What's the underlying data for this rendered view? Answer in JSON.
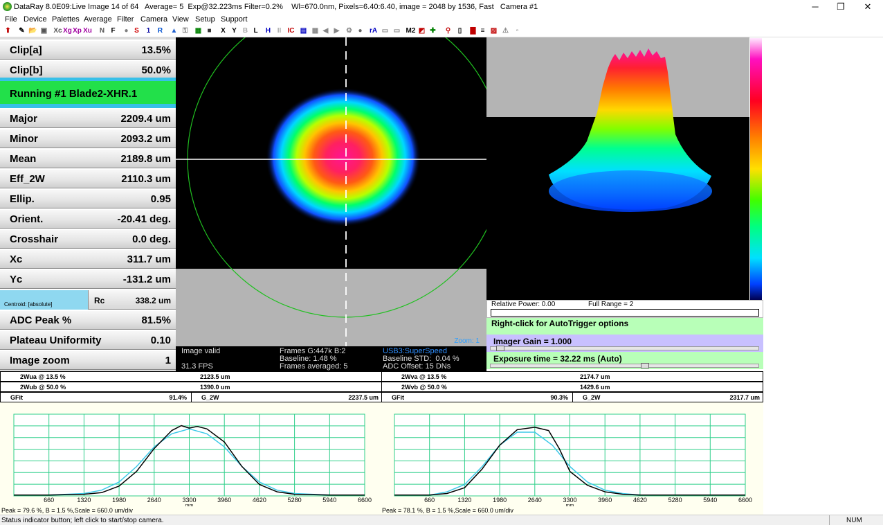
{
  "titlebar": {
    "title": "DataRay 8.0E09:Live Image 14 of 64   Average= 5  Exp@32.223ms Filter=0.2%    Wl=670.0nm, Pixels=6.40:6.40, image = 2048 by 1536, Fast   Camera #1",
    "minimize": "─",
    "maximize": "❐",
    "close": "✕"
  },
  "menu": [
    "File",
    "Device",
    "Palettes",
    "Average",
    "Filter",
    "Camera",
    "View",
    "Setup",
    "Support"
  ],
  "toolbar": [
    {
      "label": "⬆",
      "color": "#c00000"
    },
    {
      "label": "✎",
      "color": "#000"
    },
    {
      "label": "📂",
      "color": "#b08000"
    },
    {
      "label": "▣",
      "color": "#555"
    },
    {
      "label": "Xc",
      "color": "#555"
    },
    {
      "label": "Xg",
      "color": "#a000a0"
    },
    {
      "label": "Xp",
      "color": "#a000a0"
    },
    {
      "label": "Xu",
      "color": "#a000a0"
    },
    {
      "label": "N",
      "color": "#555"
    },
    {
      "label": "F",
      "color": "#000"
    },
    {
      "label": "●",
      "color": "#808080"
    },
    {
      "label": "S",
      "color": "#d00000"
    },
    {
      "label": "1",
      "color": "#0000a0"
    },
    {
      "label": "R",
      "color": "#0050d0"
    },
    {
      "label": "▲",
      "color": "#2060d0"
    },
    {
      "label": "⚿",
      "color": "#808080"
    },
    {
      "label": "▦",
      "color": "#008000"
    },
    {
      "label": "■",
      "color": "#333"
    },
    {
      "label": "X",
      "color": "#000"
    },
    {
      "label": "Y",
      "color": "#000"
    },
    {
      "label": "B",
      "color": "#aaa"
    },
    {
      "label": "L",
      "color": "#000"
    },
    {
      "label": "H",
      "color": "#0000c0"
    },
    {
      "label": "II",
      "color": "#aaa"
    },
    {
      "label": "IC",
      "color": "#c00000"
    },
    {
      "label": "▤",
      "color": "#0000c0"
    },
    {
      "label": "▦",
      "color": "#888"
    },
    {
      "label": "◀",
      "color": "#888"
    },
    {
      "label": "▶",
      "color": "#888"
    },
    {
      "label": "⚙",
      "color": "#888"
    },
    {
      "label": "●",
      "color": "#666"
    },
    {
      "label": "rA",
      "color": "#0000c0"
    },
    {
      "label": "▭",
      "color": "#888"
    },
    {
      "label": "▭",
      "color": "#888"
    },
    {
      "label": "M2",
      "color": "#000"
    },
    {
      "label": "◩",
      "color": "#c00000"
    },
    {
      "label": "✚",
      "color": "#008000"
    },
    {
      "label": "⚲",
      "color": "#c00000"
    },
    {
      "label": "▯",
      "color": "#000"
    },
    {
      "label": "▇",
      "color": "#c00000"
    },
    {
      "label": "≡",
      "color": "#000"
    },
    {
      "label": "▨",
      "color": "#c00000"
    },
    {
      "label": "⚠",
      "color": "#888"
    },
    {
      "label": "▫",
      "color": "#888"
    }
  ],
  "measurements": {
    "clip_a": {
      "label": "Clip[a]",
      "value": "13.5%"
    },
    "clip_b": {
      "label": "Clip[b]",
      "value": "50.0%"
    },
    "running": "Running #1 Blade2-XHR.1",
    "major": {
      "label": "Major",
      "value": "2209.4 um"
    },
    "minor": {
      "label": "Minor",
      "value": "2093.2 um"
    },
    "mean": {
      "label": "Mean",
      "value": "2189.8 um"
    },
    "eff2w": {
      "label": "Eff_2W",
      "value": "2110.3 um"
    },
    "ellip": {
      "label": "Ellip.",
      "value": "0.95"
    },
    "orient": {
      "label": "Orient.",
      "value": "-20.41 deg."
    },
    "crosshair": {
      "label": "Crosshair",
      "value": "0.0 deg."
    },
    "xc": {
      "label": "Xc",
      "value": "311.7 um"
    },
    "yc": {
      "label": "Yc",
      "value": "-131.2 um"
    },
    "centroid": {
      "label": "Centroid: [absolute]",
      "rlabel": "Rc",
      "value": "338.2 um"
    },
    "adc_peak": {
      "label": "ADC Peak %",
      "value": "81.5%"
    },
    "plateau": {
      "label": "Plateau Uniformity",
      "value": "0.10"
    },
    "zoom": {
      "label": "Image zoom",
      "value": "1"
    }
  },
  "viewer2d": {
    "zoom_label": "Zoom: 1"
  },
  "info": {
    "image_valid": "Image valid",
    "fps": "31.3 FPS",
    "frames": "Frames G:447k B:2",
    "baseline": "Baseline: 1.48 %",
    "frames_avg": "Frames averaged: 5",
    "usb": "USB3:SuperSpeed",
    "baseline_std": "Baseline STD:  0.04 %",
    "adc_offset": "ADC Offset: 15 DNs"
  },
  "controls": {
    "relative_power": "Relative Power: 0.00",
    "full_range": "Full Range = 2",
    "autotrigger": "Right-click for AutoTrigger options",
    "imager_gain": "Imager Gain = 1.000",
    "exposure": "Exposure time = 32.22 ms (Auto)",
    "gain_level": 0.02,
    "exposure_level": 0.58
  },
  "tables": {
    "left": [
      {
        "label": "2Wua @ 13.5 %",
        "value": "2123.5 um"
      },
      {
        "label": "2Wub @ 50.0 %",
        "value": "1390.0 um"
      }
    ],
    "right": [
      {
        "label": "2Wva @ 13.5 %",
        "value": "2174.7 um"
      },
      {
        "label": "2Wvb @ 50.0 %",
        "value": "1429.6 um"
      }
    ],
    "gfit_left": {
      "label": "GFit",
      "value": "91.4%",
      "g2w_label": "G_2W",
      "g2w_value": "2237.5 um"
    },
    "gfit_right": {
      "label": "GFit",
      "value": "90.3%",
      "g2w_label": "G_2W",
      "g2w_value": "2317.7 um"
    }
  },
  "plots": {
    "left_caption": "Peak = 79.6 %, B = 1.5 %,Scale = 660.0 um/div",
    "right_caption": "Peak = 78.1 %, B = 1.5 %,Scale = 660.0 um/div",
    "axis_unit": "mm",
    "grid_color": "#2fcf8a",
    "measured_color": "#000000",
    "fit_color": "#3cc8e8"
  },
  "chart_data": [
    {
      "type": "line",
      "xlabel": "mm",
      "x_ticks": [
        660,
        1320,
        1980,
        2640,
        3300,
        3960,
        4620,
        5280,
        5940,
        6600
      ],
      "xlim": [
        0,
        6600
      ],
      "ylim": [
        0,
        100
      ],
      "series": [
        {
          "x": [
            0,
            660,
            1320,
            1650,
            1980,
            2310,
            2640,
            2970,
            3150,
            3300,
            3450,
            3630,
            3960,
            4290,
            4620,
            4950,
            5280,
            5940,
            6600
          ],
          "values": [
            1,
            1,
            2,
            4,
            12,
            30,
            58,
            80,
            86,
            83,
            85,
            82,
            66,
            36,
            14,
            5,
            2,
            1,
            1
          ]
        },
        {
          "x": [
            0,
            660,
            1320,
            1650,
            1980,
            2310,
            2640,
            2970,
            3300,
            3630,
            3960,
            4290,
            4620,
            4950,
            5280,
            5940,
            6600
          ],
          "values": [
            1,
            1,
            3,
            7,
            17,
            36,
            60,
            76,
            82,
            76,
            60,
            36,
            17,
            7,
            3,
            1,
            1
          ]
        }
      ]
    },
    {
      "type": "line",
      "xlabel": "mm",
      "x_ticks": [
        660,
        1320,
        1980,
        2640,
        3300,
        3960,
        4620,
        5280,
        5940,
        6600
      ],
      "xlim": [
        0,
        6600
      ],
      "ylim": [
        0,
        100
      ],
      "series": [
        {
          "x": [
            0,
            660,
            990,
            1320,
            1650,
            1980,
            2310,
            2640,
            2900,
            3100,
            3300,
            3630,
            3960,
            4290,
            4620,
            5280,
            5940,
            6600
          ],
          "values": [
            1,
            1,
            3,
            10,
            33,
            62,
            81,
            84,
            80,
            58,
            30,
            13,
            5,
            2,
            1,
            1,
            1,
            1
          ]
        },
        {
          "x": [
            0,
            660,
            990,
            1320,
            1650,
            1980,
            2310,
            2640,
            2970,
            3300,
            3630,
            3960,
            4290,
            4620,
            5280,
            5940,
            6600
          ],
          "values": [
            1,
            1,
            5,
            14,
            36,
            62,
            78,
            78,
            62,
            36,
            17,
            7,
            3,
            1,
            1,
            1,
            1
          ]
        }
      ]
    }
  ],
  "statusbar": {
    "text": "Status indicator button; left click to start/stop camera.",
    "num": "NUM"
  }
}
